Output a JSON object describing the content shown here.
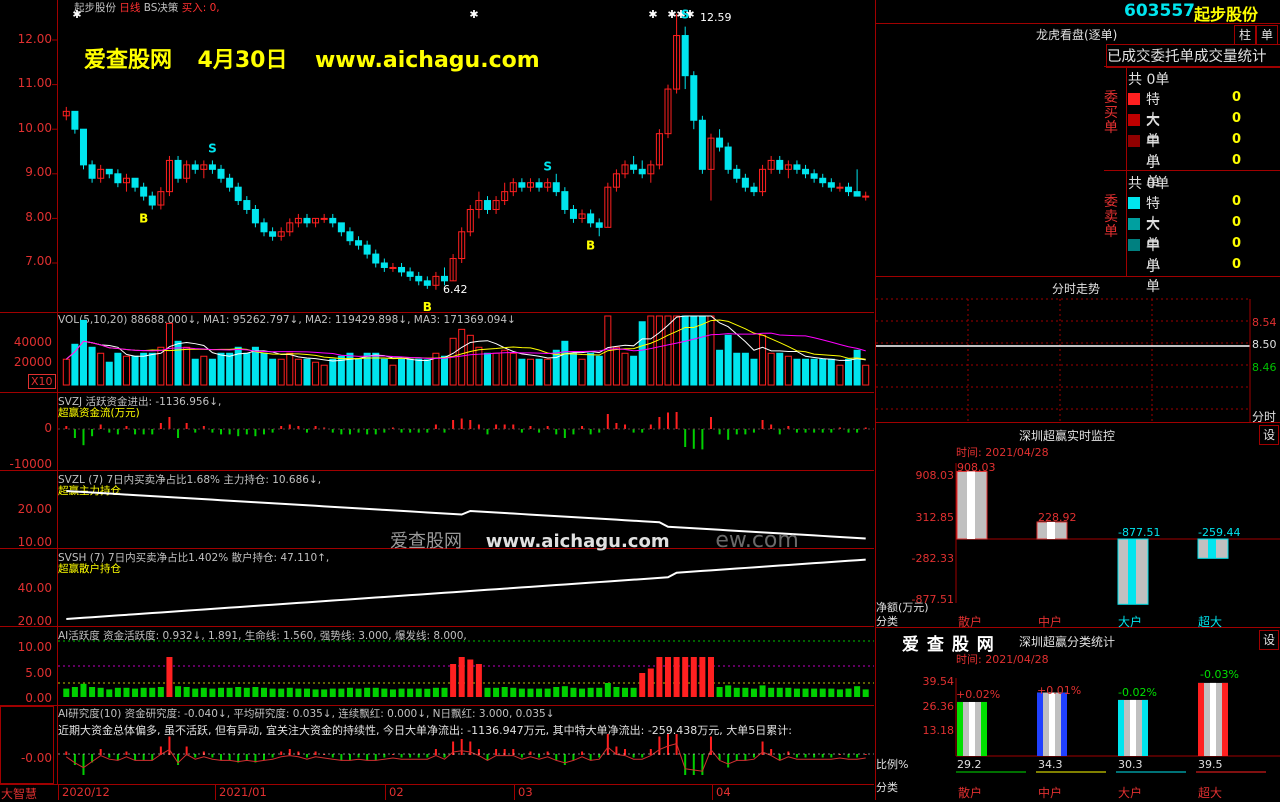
{
  "header": {
    "stock_name": "起步股份",
    "period": "日线",
    "strategy": "BS决策",
    "buy_label": "买入: 0,"
  },
  "watermark": {
    "site": "爱查股网",
    "date": "4月30日",
    "url": "www.aichagu.com",
    "mid_site": "爱查股网",
    "mid_url": "www.aichagu.com",
    "mid_suffix": "ew.com"
  },
  "price": {
    "axis": [
      "12.00",
      "11.00",
      "10.00",
      "9.00",
      "8.00",
      "7.00"
    ],
    "high_label": "12.59",
    "low_label": "6.42",
    "markers": {
      "buy": "B",
      "sell": "S"
    },
    "candles": [
      [
        10.3,
        10.5,
        10.2,
        10.4
      ],
      [
        10.4,
        10.4,
        9.9,
        10.0
      ],
      [
        10.0,
        10.0,
        9.1,
        9.2
      ],
      [
        9.2,
        9.3,
        8.8,
        8.9
      ],
      [
        8.9,
        9.2,
        8.8,
        9.1
      ],
      [
        9.1,
        9.1,
        8.9,
        9.0
      ],
      [
        9.0,
        9.1,
        8.7,
        8.8
      ],
      [
        8.8,
        9.0,
        8.6,
        8.9
      ],
      [
        8.9,
        8.9,
        8.6,
        8.7
      ],
      [
        8.7,
        8.8,
        8.4,
        8.5
      ],
      [
        8.5,
        8.6,
        8.2,
        8.3
      ],
      [
        8.3,
        8.7,
        8.2,
        8.6
      ],
      [
        8.6,
        9.4,
        8.5,
        9.3
      ],
      [
        9.3,
        9.4,
        8.8,
        8.9
      ],
      [
        8.9,
        9.3,
        8.8,
        9.2
      ],
      [
        9.2,
        9.3,
        9.0,
        9.1
      ],
      [
        9.1,
        9.3,
        8.9,
        9.2
      ],
      [
        9.2,
        9.3,
        9.0,
        9.1
      ],
      [
        9.1,
        9.2,
        8.8,
        8.9
      ],
      [
        8.9,
        9.0,
        8.6,
        8.7
      ],
      [
        8.7,
        8.8,
        8.3,
        8.4
      ],
      [
        8.4,
        8.5,
        8.1,
        8.2
      ],
      [
        8.2,
        8.3,
        7.8,
        7.9
      ],
      [
        7.9,
        8.0,
        7.6,
        7.7
      ],
      [
        7.7,
        7.8,
        7.5,
        7.6
      ],
      [
        7.6,
        7.8,
        7.5,
        7.7
      ],
      [
        7.7,
        8.0,
        7.6,
        7.9
      ],
      [
        7.9,
        8.1,
        7.8,
        8.0
      ],
      [
        8.0,
        8.1,
        7.8,
        7.9
      ],
      [
        7.9,
        8.0,
        7.8,
        8.0
      ],
      [
        8.0,
        8.1,
        7.9,
        8.0
      ],
      [
        8.0,
        8.1,
        7.8,
        7.9
      ],
      [
        7.9,
        7.9,
        7.6,
        7.7
      ],
      [
        7.7,
        7.8,
        7.4,
        7.5
      ],
      [
        7.5,
        7.6,
        7.3,
        7.4
      ],
      [
        7.4,
        7.5,
        7.1,
        7.2
      ],
      [
        7.2,
        7.3,
        6.9,
        7.0
      ],
      [
        7.0,
        7.1,
        6.8,
        6.9
      ],
      [
        6.9,
        7.0,
        6.8,
        6.9
      ],
      [
        6.9,
        7.0,
        6.7,
        6.8
      ],
      [
        6.8,
        6.9,
        6.6,
        6.7
      ],
      [
        6.7,
        6.8,
        6.5,
        6.6
      ],
      [
        6.6,
        6.7,
        6.42,
        6.5
      ],
      [
        6.5,
        6.8,
        6.4,
        6.7
      ],
      [
        6.7,
        6.9,
        6.5,
        6.6
      ],
      [
        6.6,
        7.2,
        6.6,
        7.1
      ],
      [
        7.1,
        7.8,
        7.0,
        7.7
      ],
      [
        7.7,
        8.3,
        7.6,
        8.2
      ],
      [
        8.2,
        8.6,
        8.0,
        8.4
      ],
      [
        8.4,
        8.5,
        8.1,
        8.2
      ],
      [
        8.2,
        8.5,
        8.1,
        8.4
      ],
      [
        8.4,
        8.8,
        8.3,
        8.6
      ],
      [
        8.6,
        8.9,
        8.5,
        8.8
      ],
      [
        8.8,
        8.9,
        8.6,
        8.7
      ],
      [
        8.7,
        8.9,
        8.6,
        8.8
      ],
      [
        8.8,
        8.9,
        8.6,
        8.7
      ],
      [
        8.7,
        8.9,
        8.6,
        8.8
      ],
      [
        8.8,
        9.0,
        8.5,
        8.6
      ],
      [
        8.6,
        8.7,
        8.1,
        8.2
      ],
      [
        8.2,
        8.3,
        7.9,
        8.0
      ],
      [
        8.0,
        8.2,
        7.9,
        8.1
      ],
      [
        8.1,
        8.2,
        7.8,
        7.9
      ],
      [
        7.9,
        8.0,
        7.6,
        7.8
      ],
      [
        7.8,
        8.8,
        7.8,
        8.7
      ],
      [
        8.7,
        9.1,
        8.6,
        9.0
      ],
      [
        9.0,
        9.3,
        8.9,
        9.2
      ],
      [
        9.2,
        9.4,
        9.0,
        9.1
      ],
      [
        9.1,
        9.3,
        8.9,
        9.0
      ],
      [
        9.0,
        9.3,
        8.8,
        9.2
      ],
      [
        9.2,
        10.0,
        9.1,
        9.9
      ],
      [
        9.9,
        11.0,
        9.8,
        10.9
      ],
      [
        10.9,
        12.59,
        10.8,
        12.1
      ],
      [
        12.1,
        12.3,
        10.9,
        11.2
      ],
      [
        11.2,
        11.3,
        10.0,
        10.2
      ],
      [
        10.2,
        10.3,
        9.0,
        9.1
      ],
      [
        9.1,
        9.9,
        8.4,
        9.8
      ],
      [
        9.8,
        10.0,
        9.5,
        9.6
      ],
      [
        9.6,
        9.7,
        9.0,
        9.1
      ],
      [
        9.1,
        9.2,
        8.8,
        8.9
      ],
      [
        8.9,
        9.0,
        8.6,
        8.7
      ],
      [
        8.7,
        8.8,
        8.5,
        8.6
      ],
      [
        8.6,
        9.2,
        8.5,
        9.1
      ],
      [
        9.1,
        9.4,
        9.0,
        9.3
      ],
      [
        9.3,
        9.4,
        9.0,
        9.1
      ],
      [
        9.1,
        9.3,
        8.9,
        9.2
      ],
      [
        9.2,
        9.3,
        9.0,
        9.1
      ],
      [
        9.1,
        9.2,
        8.9,
        9.0
      ],
      [
        9.0,
        9.1,
        8.8,
        8.9
      ],
      [
        8.9,
        9.0,
        8.7,
        8.8
      ],
      [
        8.8,
        8.9,
        8.6,
        8.7
      ],
      [
        8.7,
        8.8,
        8.6,
        8.7
      ],
      [
        8.7,
        8.8,
        8.5,
        8.6
      ],
      [
        8.6,
        9.1,
        8.5,
        8.5
      ],
      [
        8.5,
        8.6,
        8.4,
        8.5
      ]
    ]
  },
  "vol": {
    "header": "VOL(5,10,20) 88688.000↓, MA1: 95262.797↓, MA2: 119429.898↓, MA3: 171369.094↓",
    "axis": [
      "40000",
      "20000"
    ],
    "unit_box": "X10"
  },
  "svzj": {
    "header": "SVZJ  活跃资金进出: -1136.956↓,",
    "sub": "超赢资金流(万元)",
    "axis": [
      "0",
      "-10000"
    ]
  },
  "svzl": {
    "header": "SVZL (7) 7日内买卖净占比1.68% 主力持仓: 10.686↓,",
    "sub": "超赢主力持仓",
    "axis": [
      "20.00",
      "10.00"
    ]
  },
  "svsh": {
    "header": "SVSH (7) 7日内买卖净占比1.402% 散户持仓: 47.110↑,",
    "sub": "超赢散户持仓",
    "axis": [
      "40.00",
      "20.00"
    ]
  },
  "ai": {
    "header": "AI活跃度 资金活跃度: 0.932↓, 1.891, 生命线: 1.560, 强势线: 3.000, 爆发线: 8.000,",
    "axis": [
      "10.00",
      "5.00",
      "0.00"
    ]
  },
  "ai_research": {
    "header": "AI研究度(10) 资金研究度: -0.040↓, 平均研究度: 0.035↓, 连续飘红: 0.000↓, N日飘红: 3.000, 0.035↓",
    "line2": "近期大资金总体偏多, 虽不活跃, 但有异动, 宜关注大资金的持续性, 今日大单净流出: -1136.947万元, 其中特大单净流出: -259.438万元, 大单5日累计:",
    "axis": "-0.00"
  },
  "bottom_axis": {
    "left_label": "大智慧",
    "dates": [
      "2020/12",
      "2021/01",
      "02",
      "03",
      "04"
    ]
  },
  "right": {
    "code": "603557",
    "name": "起步股份",
    "btn_zhu": "柱",
    "btn_dan": "单",
    "lhkp": "龙虎看盘(逐单)",
    "stat_title": "已成交委托单成交量统计",
    "buy": {
      "side": "委买单",
      "total": "共 0单",
      "rows": [
        [
          "特大",
          "0"
        ],
        [
          "大单",
          "0"
        ],
        [
          "中单",
          "0"
        ],
        [
          "小单",
          "0"
        ]
      ]
    },
    "sell": {
      "side": "委卖单",
      "total": "共 0单",
      "rows": [
        [
          "特大",
          "0"
        ],
        [
          "大单",
          "0"
        ],
        [
          "中单",
          "0"
        ],
        [
          "小单",
          "0"
        ]
      ]
    },
    "fenshi": {
      "title": "分时走势",
      "prices": [
        "8.54",
        "8.50",
        "8.46"
      ],
      "label": "分时"
    },
    "realtime": {
      "title": "深圳超赢实时监控",
      "btn": "设",
      "time": "时间: 2021/04/28",
      "axis": [
        "908.03",
        "312.85",
        "-282.33",
        "-877.51"
      ],
      "values": [
        "908.03",
        "228.92",
        "-877.51",
        "-259.44"
      ],
      "amounts": [
        908.03,
        228.92,
        -877.51,
        -259.44
      ],
      "ylabel": "净额(万元)",
      "xlabel": "分类",
      "cats": [
        "散户",
        "中户",
        "大户",
        "超大"
      ]
    },
    "classify": {
      "brand": "爱 查 股 网",
      "title": "深圳超赢分类统计",
      "btn": "设",
      "time": "时间: 2021/04/28",
      "axis": [
        "39.54",
        "26.36",
        "13.18"
      ],
      "pct_top": [
        "+0.02%",
        "+0.01%",
        "-0.02%",
        "-0.03%"
      ],
      "pct_bottom": [
        "29.2",
        "34.3",
        "30.3",
        "39.5"
      ],
      "ylabel": "比例%",
      "xlabel": "分类",
      "cats": [
        "散户",
        "中户",
        "大户",
        "超大"
      ]
    }
  },
  "colors": {
    "up": "#ff2020",
    "down": "#00e5ee",
    "grid": "#a00000",
    "yellow": "#ffff00",
    "magenta": "#ff00ff"
  }
}
